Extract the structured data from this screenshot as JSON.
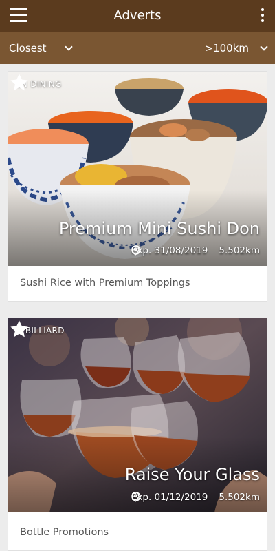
{
  "header": {
    "title": "Adverts",
    "menu_icon": "hamburger-menu-icon",
    "more_icon": "more-vert-icon"
  },
  "filters": {
    "sort": "Closest",
    "distance": ">100km"
  },
  "adverts": [
    {
      "merchant": "EN DINING",
      "title": "Premium Mini Sushi Don",
      "expiry": "Exp. 31/08/2019",
      "distance": "5.502km",
      "description": "Sushi Rice with Premium Toppings"
    },
    {
      "merchant": "Q BILLIARD",
      "title": "Raise Your Glass",
      "expiry": "Exp. 01/12/2019",
      "distance": "5.502km",
      "description": "Bottle Promotions"
    }
  ],
  "colors": {
    "appbar": "#5b3b1e",
    "filterbar": "#7a5632",
    "background": "#ececec"
  }
}
